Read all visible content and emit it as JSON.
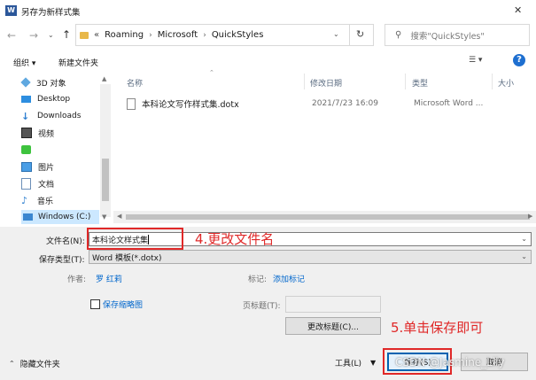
{
  "window": {
    "title": "另存为新样式集",
    "close_glyph": "✕"
  },
  "breadcrumb": {
    "prefix": "«",
    "segments": [
      "Roaming",
      "Microsoft",
      "QuickStyles"
    ]
  },
  "search": {
    "placeholder": "搜索\"QuickStyles\""
  },
  "toolbar": {
    "organize": "组织 ▾",
    "new_folder": "新建文件夹",
    "view_glyph": "☰ ▾",
    "help_glyph": "?"
  },
  "nav": {
    "items": [
      {
        "label": "3D 对象",
        "icon": "cube-icon"
      },
      {
        "label": "Desktop",
        "icon": "desktop-icon"
      },
      {
        "label": "Downloads",
        "icon": "download-icon"
      },
      {
        "label": "视频",
        "icon": "video-icon"
      },
      {
        "label": "",
        "icon": "wechat-icon"
      },
      {
        "label": "图片",
        "icon": "picture-icon"
      },
      {
        "label": "文档",
        "icon": "document-icon"
      },
      {
        "label": "音乐",
        "icon": "music-icon"
      },
      {
        "label": "Windows (C:)",
        "icon": "drive-icon"
      }
    ]
  },
  "columns": {
    "name": "名称",
    "modified": "修改日期",
    "type": "类型",
    "size": "大小"
  },
  "files": [
    {
      "name": "本科论文写作样式集.dotx",
      "modified": "2021/7/23 16:09",
      "type": "Microsoft Word ..."
    }
  ],
  "form": {
    "filename_label": "文件名(N):",
    "filename_value": "本科论文样式集",
    "filetype_label": "保存类型(T):",
    "filetype_value": "Word 模板(*.dotx)",
    "author_label": "作者:",
    "author_value": "罗 红莉",
    "tags_label": "标记:",
    "tags_value": "添加标记",
    "thumbnail_label": "保存缩略图",
    "page_title_label": "页标题(T):",
    "change_title_button": "更改标题(C)..."
  },
  "footer": {
    "hide_folders": "隐藏文件夹",
    "tools": "工具(L)",
    "save": "保存(S)",
    "cancel": "取消"
  },
  "annotations": {
    "step4": "4.更改文件名",
    "step5": "5.单击保存即可"
  },
  "watermark": "CSDN @Jasmine_Lily",
  "colors": {
    "accent": "#0063b1",
    "annotation": "#e02828",
    "link": "#0066cc"
  }
}
